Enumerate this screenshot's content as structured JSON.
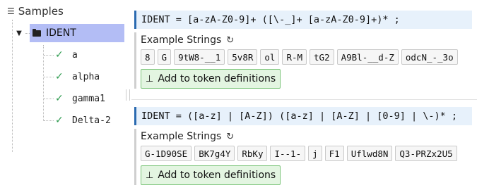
{
  "tree": {
    "header": "Samples",
    "root": {
      "label": "IDENT"
    },
    "children": [
      "a",
      "alpha",
      "gamma1",
      "Delta-2"
    ]
  },
  "blocks": [
    {
      "rule": "IDENT = [a-zA-Z0-9]+ ([\\-_]+ [a-zA-Z0-9]+)* ;",
      "examples_title": "Example Strings",
      "chips": [
        "8",
        "G",
        "9tW8-__1",
        "5v8R",
        "ol",
        "R-M",
        "tG2",
        "A9Bl-__d-Z",
        "odcN_-_3o"
      ],
      "add_label": "Add to token definitions"
    },
    {
      "rule": "IDENT = ([a-z] | [A-Z]) ([a-z] | [A-Z] | [0-9] | \\-)* ;",
      "examples_title": "Example Strings",
      "chips": [
        "G-1D90SE",
        "BK7g4Y",
        "RbKy",
        "I--1-",
        "j",
        "F1",
        "Uflwd8N",
        "Q3-PRZx2U5"
      ],
      "add_label": "Add to token definitions"
    }
  ],
  "colors": {
    "selection": "#b3bdf5",
    "rule_bg": "#e7f1fb",
    "rule_accent": "#2a6ab0",
    "check": "#2e9b4f",
    "button_bg": "#e3f5e1",
    "button_border": "#7cc57a"
  }
}
